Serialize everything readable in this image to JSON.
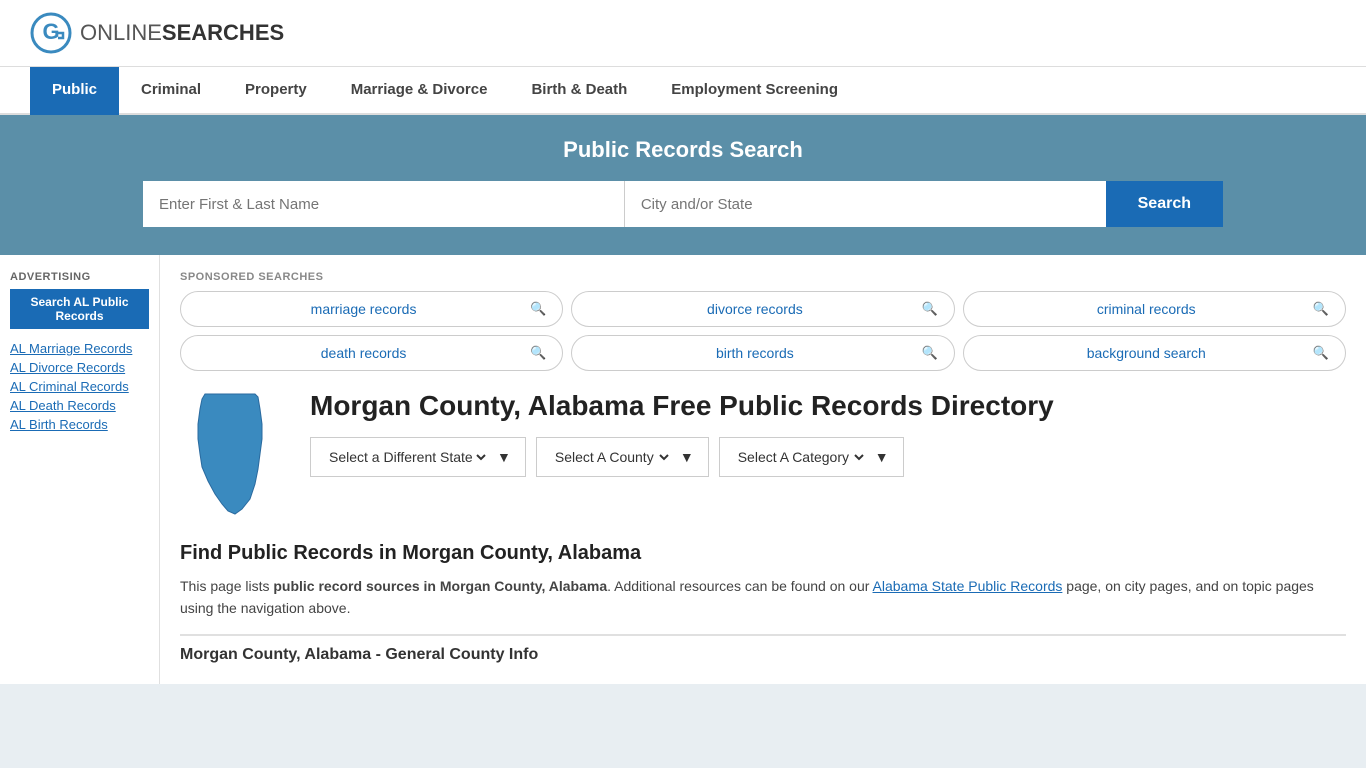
{
  "header": {
    "logo_text_plain": "ONLINE",
    "logo_text_bold": "SEARCHES"
  },
  "nav": {
    "items": [
      {
        "label": "Public",
        "active": true
      },
      {
        "label": "Criminal",
        "active": false
      },
      {
        "label": "Property",
        "active": false
      },
      {
        "label": "Marriage & Divorce",
        "active": false
      },
      {
        "label": "Birth & Death",
        "active": false
      },
      {
        "label": "Employment Screening",
        "active": false
      }
    ]
  },
  "hero": {
    "title": "Public Records Search",
    "name_placeholder": "Enter First & Last Name",
    "location_placeholder": "City and/or State",
    "search_button": "Search"
  },
  "sponsored": {
    "label": "SPONSORED SEARCHES",
    "pills": [
      {
        "text": "marriage records"
      },
      {
        "text": "divorce records"
      },
      {
        "text": "criminal records"
      },
      {
        "text": "death records"
      },
      {
        "text": "birth records"
      },
      {
        "text": "background search"
      }
    ]
  },
  "directory": {
    "title": "Morgan County, Alabama Free Public Records Directory",
    "dropdowns": {
      "state": "Select a Different State",
      "county": "Select A County",
      "category": "Select A Category"
    }
  },
  "find_section": {
    "title": "Find Public Records in Morgan County, Alabama",
    "description_part1": "This page lists ",
    "description_bold": "public record sources in Morgan County, Alabama",
    "description_part2": ". Additional resources can be found on our ",
    "link_text": "Alabama State Public Records",
    "description_part3": " page, on city pages, and on topic pages using the navigation above."
  },
  "county_info": {
    "title": "Morgan County, Alabama - General County Info"
  },
  "sidebar": {
    "ad_label": "Advertising",
    "ad_button": "Search AL Public Records",
    "links": [
      "AL Marriage Records",
      "AL Divorce Records",
      "AL Criminal Records",
      "AL Death Records",
      "AL Birth Records"
    ]
  }
}
